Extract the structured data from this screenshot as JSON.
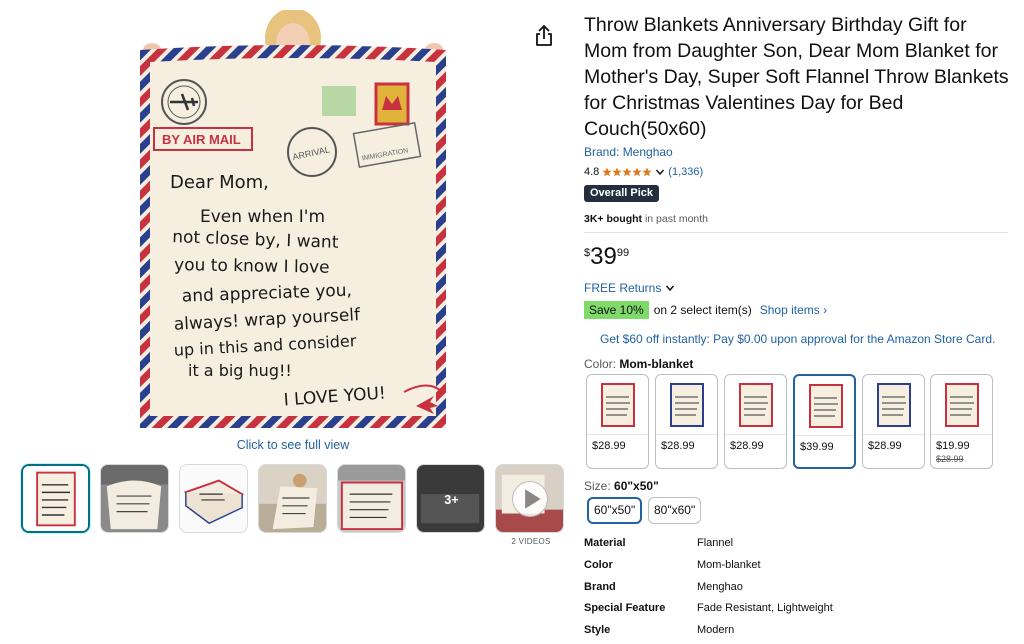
{
  "gallery": {
    "full_view_link": "Click to see full view",
    "thumbnails": [
      {
        "icon": "letter-blanket-thumbnail"
      },
      {
        "icon": "blanket-on-chair-thumbnail"
      },
      {
        "icon": "folded-blanket-thumbnail"
      },
      {
        "icon": "blanket-on-couch-thumbnail"
      },
      {
        "icon": "blanket-on-bed-thumbnail"
      },
      {
        "icon": "more-images-thumbnail",
        "overlay": "3+"
      },
      {
        "icon": "video-thumbnail"
      }
    ],
    "videos_label": "2 VIDEOS"
  },
  "blanket": {
    "stamp_text": "BY AIR MAIL",
    "arrival_stamp": "ARRIVAL",
    "immigration_stamp": "IMMIGRATION",
    "letter_greeting": "Dear Mom,",
    "letter_lines": [
      "Even when I'm",
      "not close by, I want",
      "you to know I love",
      "and appreciate you,",
      "always! wrap yourself",
      "up in this and consider",
      "it a big hug!!",
      "I LOVE YOU!"
    ]
  },
  "product": {
    "title": "Throw Blankets Anniversary Birthday Gift for Mom from Daughter Son, Dear Mom Blanket for Mother's Day, Super Soft Flannel Throw Blankets for Christmas Valentines Day for Bed Couch(50x60)",
    "brand": "Brand: Menghao",
    "rating": "4.8",
    "rating_count": "(1,336)",
    "badge": "Overall Pick",
    "bought_bold": "3K+ bought",
    "bought_rest": " in past month",
    "price": {
      "symbol": "$",
      "whole": "39",
      "fraction": "99"
    },
    "returns": "FREE Returns",
    "coupon": {
      "save": "Save 10%",
      "text": "on 2 select item(s)",
      "link": "Shop items ›"
    },
    "card_offer": "Get $60 off instantly: Pay $0.00 upon approval for the Amazon Store Card."
  },
  "color": {
    "label": "Color: ",
    "selected": "Mom-blanket",
    "options": [
      {
        "price": "$28.99",
        "old": ""
      },
      {
        "price": "$28.99",
        "old": ""
      },
      {
        "price": "$28.99",
        "old": ""
      },
      {
        "price": "$39.99",
        "old": ""
      },
      {
        "price": "$28.99",
        "old": ""
      },
      {
        "price": "$19.99",
        "old": "$28.99"
      }
    ]
  },
  "size": {
    "label": "Size: ",
    "selected": "60\"x50\"",
    "options": [
      "60\"x50\"",
      "80\"x60\""
    ]
  },
  "specs": [
    {
      "key": "Material",
      "value": "Flannel"
    },
    {
      "key": "Color",
      "value": "Mom-blanket"
    },
    {
      "key": "Brand",
      "value": "Menghao"
    },
    {
      "key": "Special Feature",
      "value": "Fade Resistant, Lightweight"
    },
    {
      "key": "Style",
      "value": "Modern"
    }
  ],
  "colors": {
    "link": "#2162a1",
    "selected_border": "#2162a1",
    "save_badge": "#7fda69",
    "badge_bg": "#232f3e",
    "star": "#de7921"
  }
}
